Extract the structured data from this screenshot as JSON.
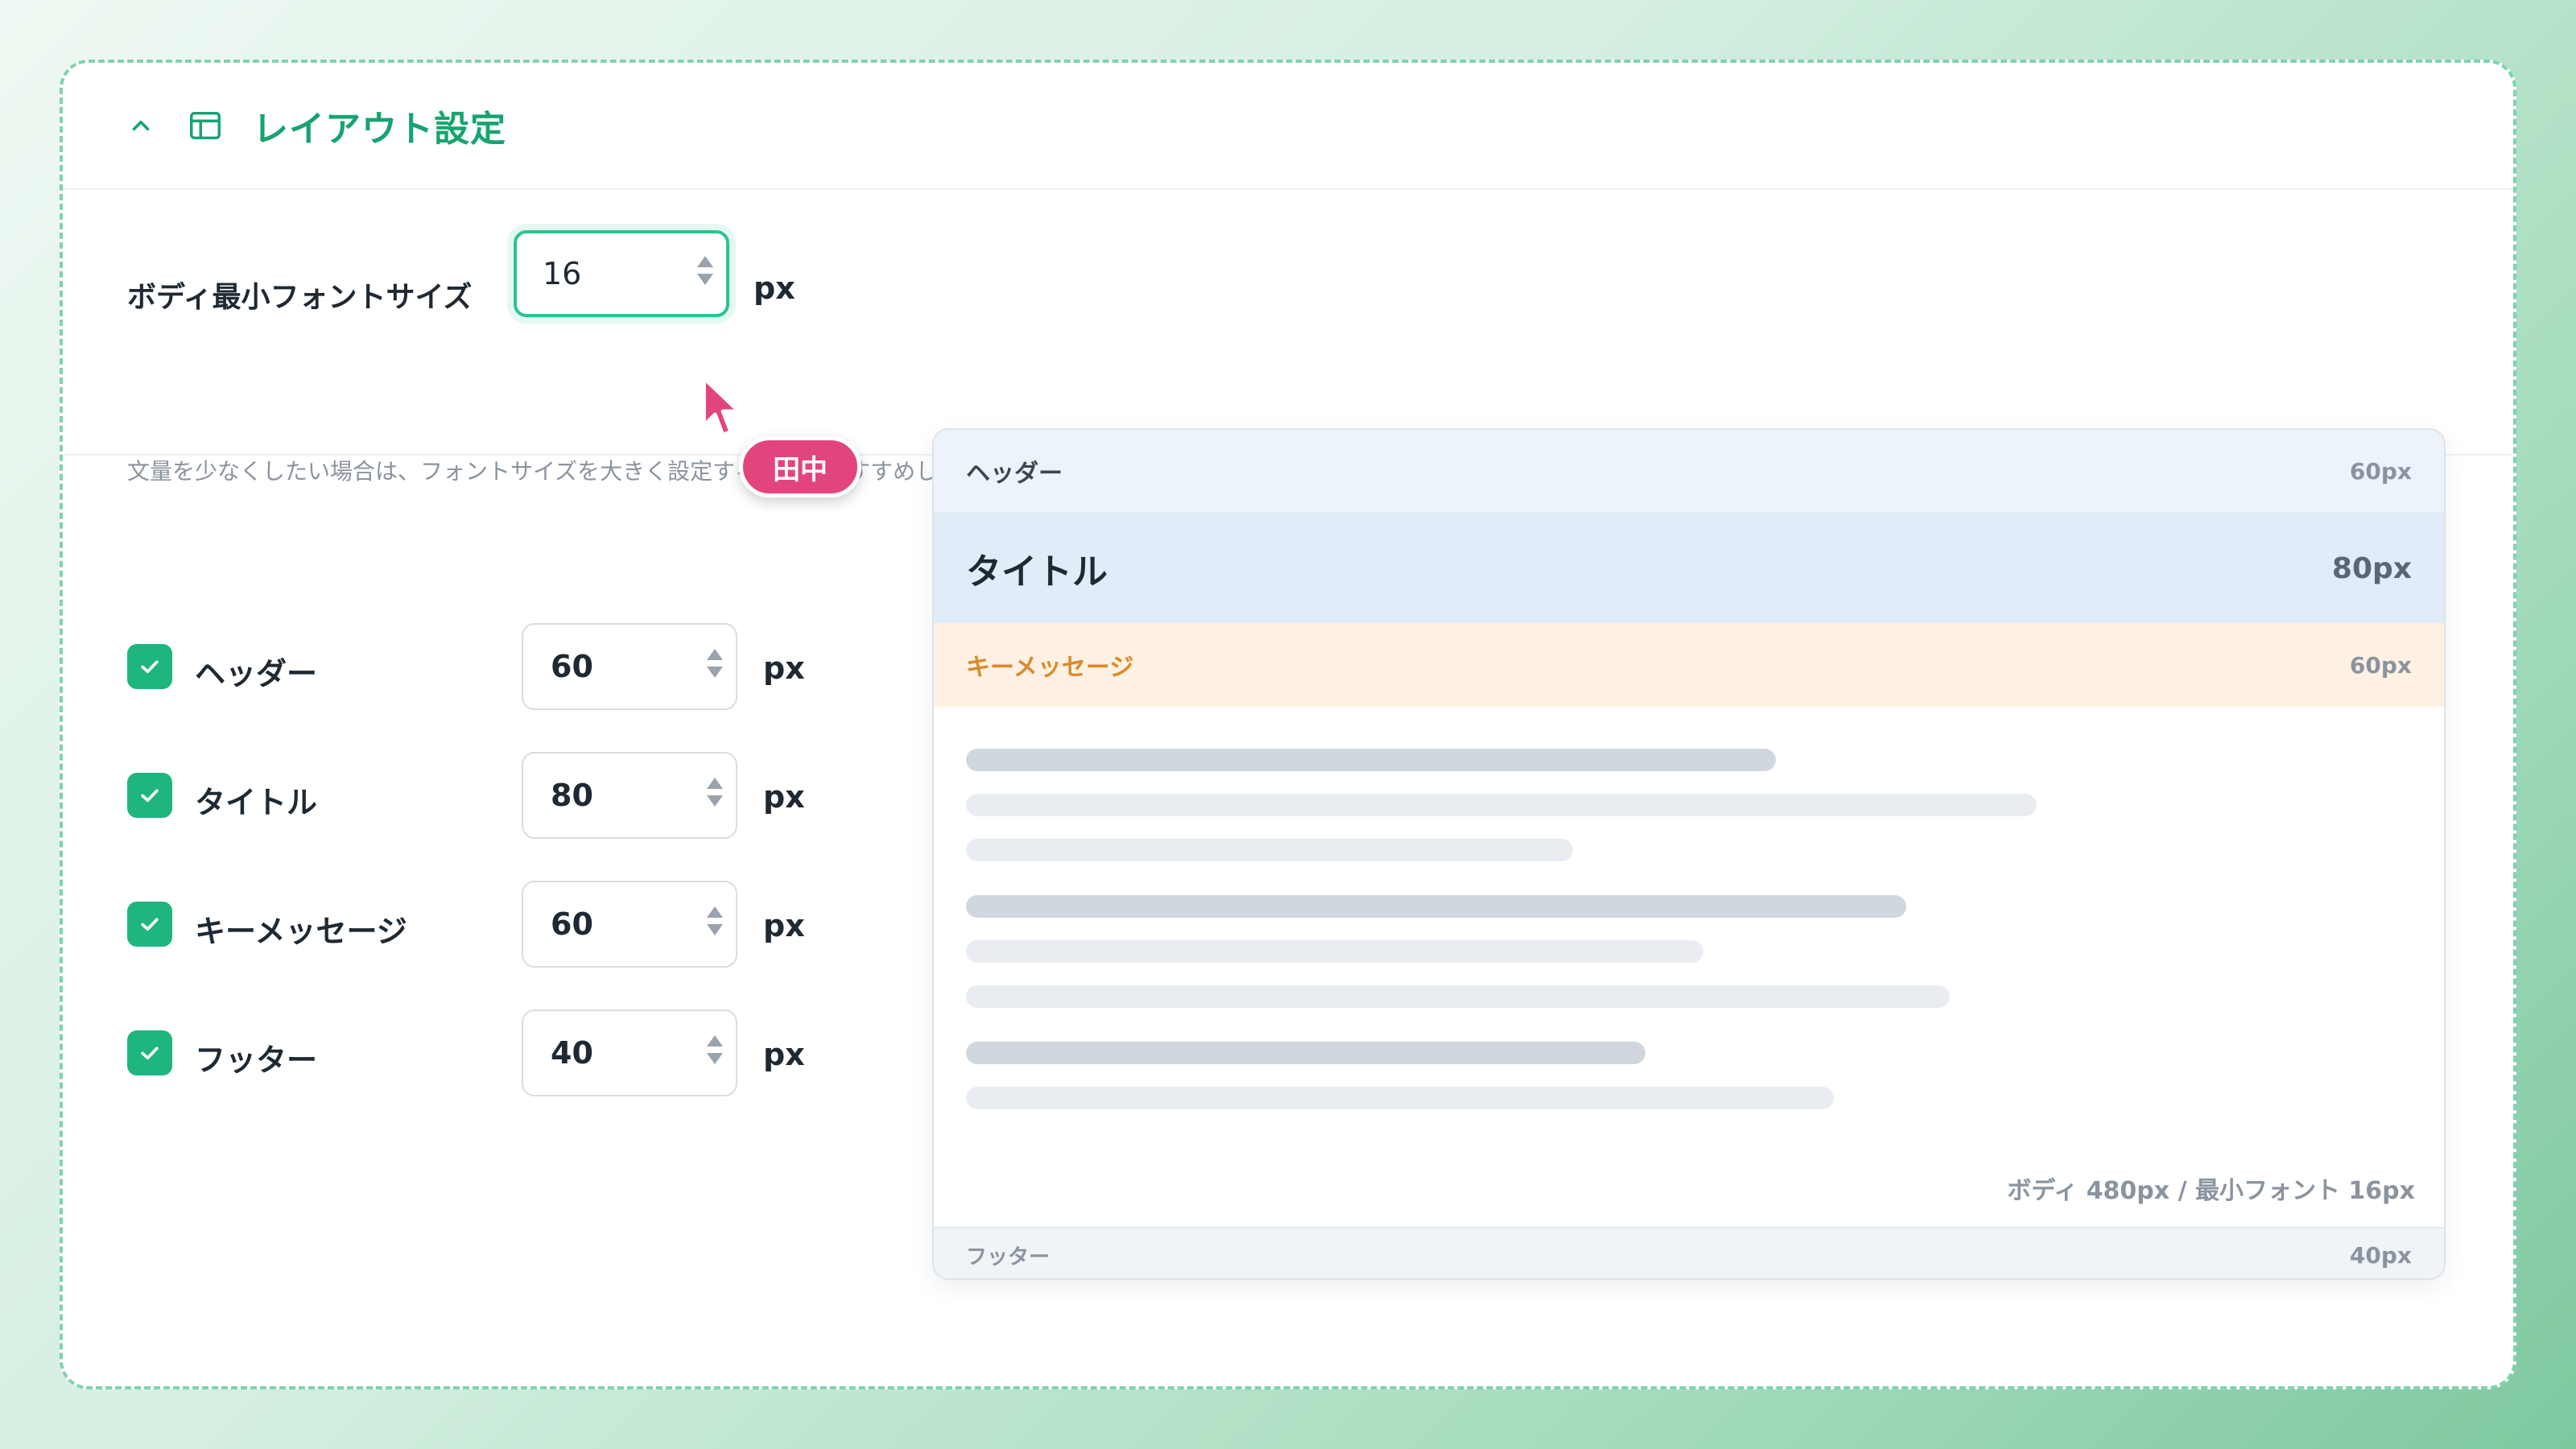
{
  "panel": {
    "title": "レイアウト設定",
    "icons": {
      "collapse": "chevron-up-icon",
      "section": "layout-icon"
    },
    "accent_color": "#16a46f"
  },
  "body_font": {
    "label": "ボディ最小フォントサイズ",
    "value": "16",
    "unit": "px",
    "hint": "文量を少なくしたい場合は、フォントサイズを大きく設定することをおすすめします。"
  },
  "collaborator": {
    "name": "田中",
    "color": "#e2457d"
  },
  "sections": [
    {
      "label": "ヘッダー",
      "checked": true,
      "value": "60",
      "unit": "px"
    },
    {
      "label": "タイトル",
      "checked": true,
      "value": "80",
      "unit": "px"
    },
    {
      "label": "キーメッセージ",
      "checked": true,
      "value": "60",
      "unit": "px"
    },
    {
      "label": "フッター",
      "checked": true,
      "value": "40",
      "unit": "px"
    }
  ],
  "preview": {
    "header": {
      "label": "ヘッダー",
      "size": "60px"
    },
    "title": {
      "label": "タイトル",
      "size": "80px"
    },
    "key": {
      "label": "キーメッセージ",
      "size": "60px"
    },
    "body_caption": "ボディ 480px / 最小フォント 16px",
    "footer": {
      "label": "フッター",
      "size": "40px"
    }
  }
}
